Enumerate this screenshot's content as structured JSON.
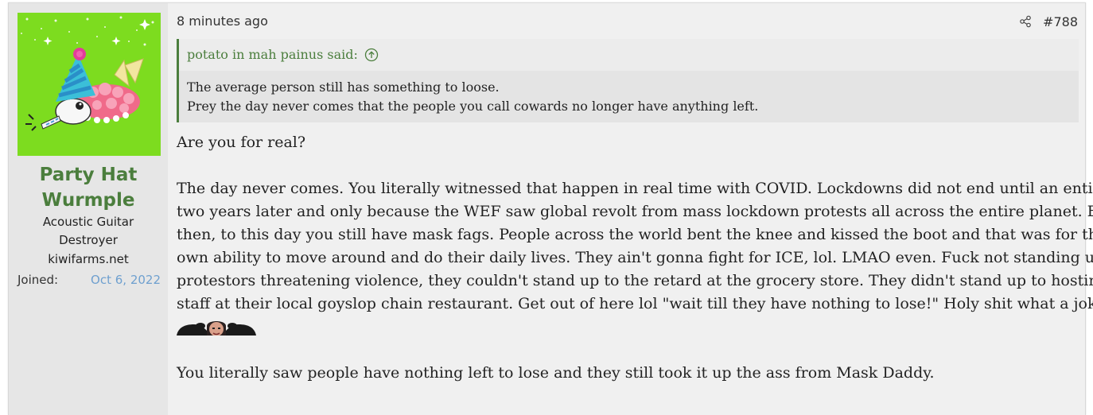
{
  "user": {
    "name_line1": "Party Hat",
    "name_line2": "Wurmple",
    "title_line1": "Acoustic Guitar",
    "title_line2": "Destroyer",
    "site": "kiwifarms.net",
    "joined_label": "Joined:",
    "joined_date": "Oct 6, 2022",
    "avatar_icon": "party-hat-wurmple-avatar"
  },
  "post": {
    "time": "8 minutes ago",
    "number": "#788",
    "share_icon": "share-icon"
  },
  "quote": {
    "author": "potato in mah painus said:",
    "lines": [
      "The average person still has something to loose.",
      "Prey the day never comes that the people you call cowards no longer have anything left."
    ]
  },
  "body": {
    "line1": "Are you for real?",
    "paragraph2": [
      "The day never comes. You literally witnessed that happen in real time with COVID. Lockdowns did not end until an entire",
      "two years later and only because the WEF saw global revolt from mass lockdown protests all across the entire planet. Even",
      "then, to this day you still have mask fags. People across the world bent the knee and kissed the boot and that was for their",
      "own ability to move around and do their daily lives. They ain't gonna fight for ICE, lol. LMAO even. Fuck not standing up to",
      "protestors threatening violence, they couldn't stand up to the retard at the grocery store. They didn't stand up to hosting",
      "staff at their local goyslop chain restaurant. Get out of here lol \"wait till they have nothing to lose!\" Holy shit what a joke."
    ],
    "last_line": "You literally saw people have nothing left to lose and they still took it up the ass from Mask Daddy."
  },
  "colors": {
    "accent_green": "#4b7e3d",
    "link_blue": "#6fa0cf",
    "avatar_bg": "#7ddc1f"
  }
}
